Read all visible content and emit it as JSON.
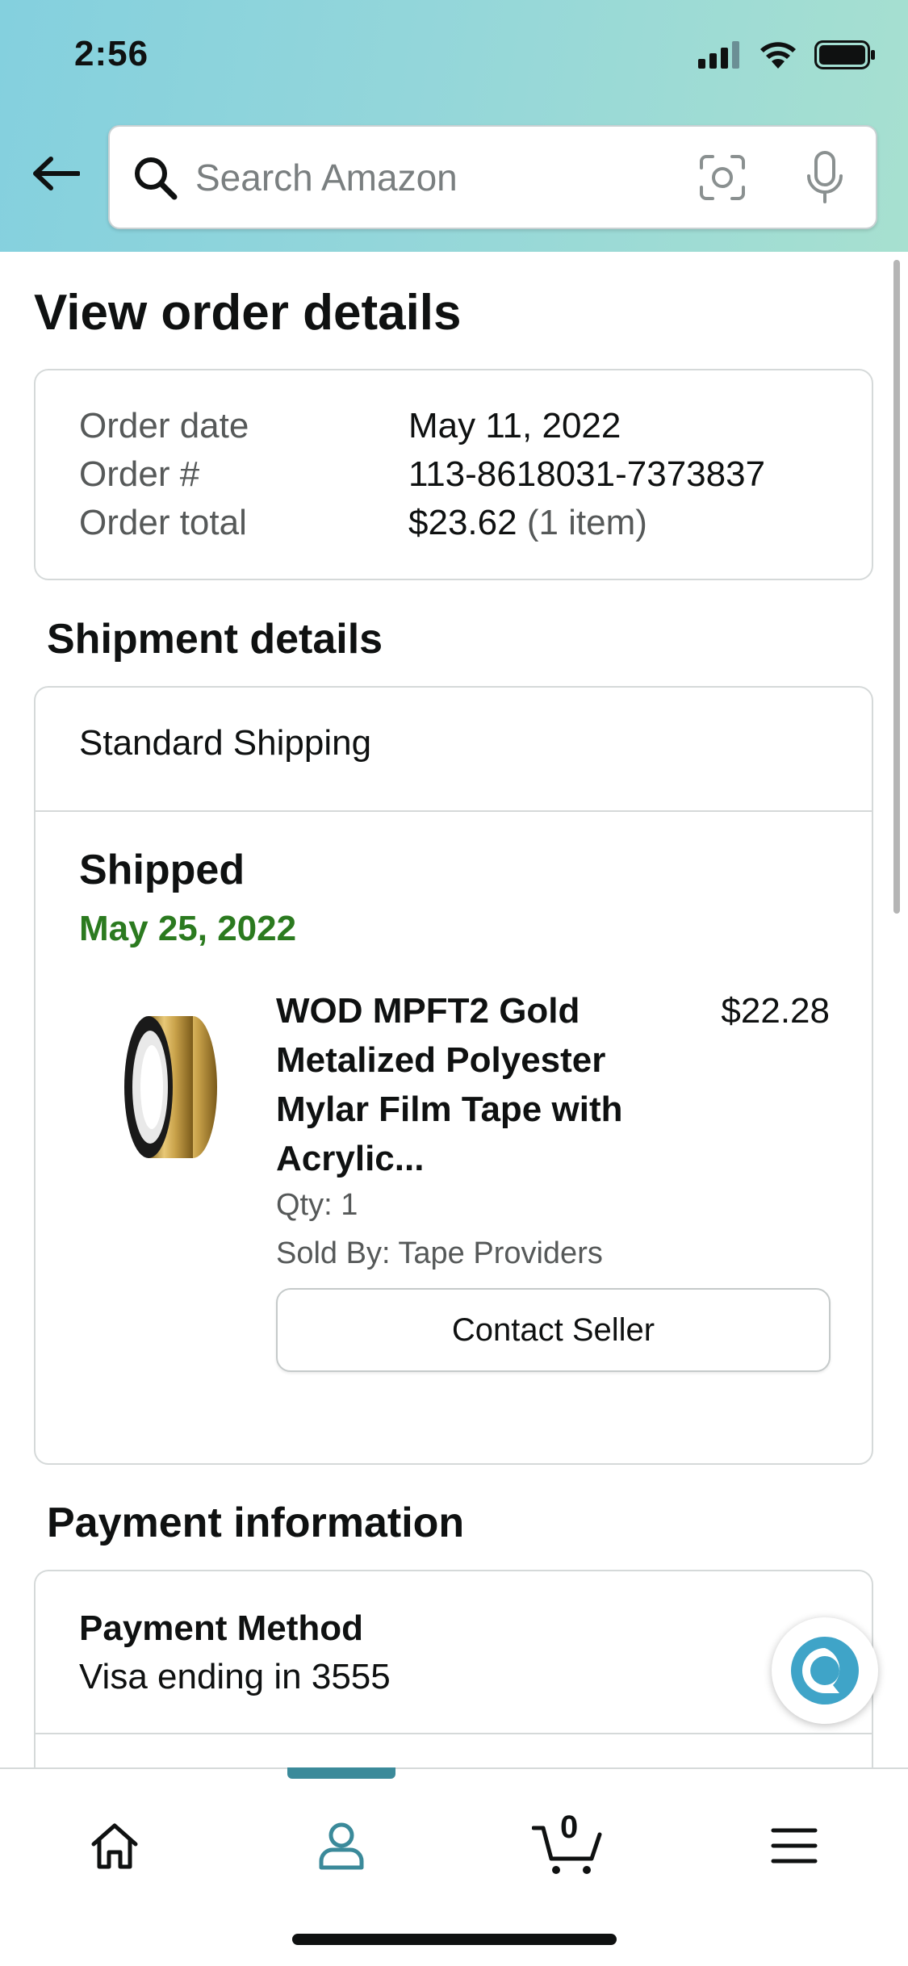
{
  "status_bar": {
    "time": "2:56"
  },
  "search": {
    "placeholder": "Search Amazon"
  },
  "page": {
    "title": "View order details"
  },
  "order_summary": {
    "rows": [
      {
        "label": "Order date",
        "value": "May 11, 2022",
        "note": ""
      },
      {
        "label": "Order #",
        "value": "113-8618031-7373837",
        "note": ""
      },
      {
        "label": "Order total",
        "value": "$23.62",
        "note": "(1 item)"
      }
    ]
  },
  "shipment": {
    "section_title": "Shipment details",
    "method": "Standard Shipping",
    "status": "Shipped",
    "date": "May 25, 2022",
    "item": {
      "title": "WOD MPFT2 Gold Metalized Polyester Mylar Film Tape with Acrylic...",
      "price": "$22.28",
      "qty": "Qty: 1",
      "sold_by": "Sold By: Tape Providers",
      "contact_button": "Contact Seller"
    }
  },
  "payment": {
    "section_title": "Payment information",
    "method_label": "Payment Method",
    "method_value": "Visa ending in 3555"
  },
  "bottom_nav": {
    "cart_count": "0",
    "items": [
      "home-icon",
      "account-icon",
      "cart-icon",
      "menu-icon"
    ],
    "active": "account-icon"
  },
  "colors": {
    "shipped_date": "#2b7a1f",
    "nav_active": "#3b8a9a",
    "header_gradient_start": "#84d0de",
    "header_gradient_end": "#a7e0d0"
  }
}
